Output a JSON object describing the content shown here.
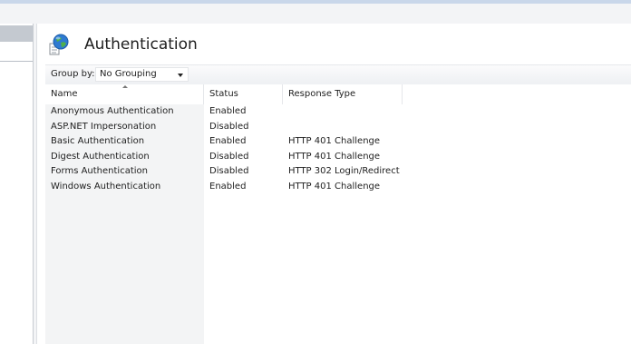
{
  "page": {
    "title": "Authentication",
    "icon": "globe-document-icon"
  },
  "group_by": {
    "label": "Group by:",
    "selected": "No Grouping"
  },
  "table": {
    "columns": [
      "Name",
      "Status",
      "Response Type"
    ],
    "sorted_column": "Name",
    "rows": [
      {
        "name": "Anonymous Authentication",
        "status": "Enabled",
        "response_type": ""
      },
      {
        "name": "ASP.NET Impersonation",
        "status": "Disabled",
        "response_type": ""
      },
      {
        "name": "Basic Authentication",
        "status": "Enabled",
        "response_type": "HTTP 401 Challenge"
      },
      {
        "name": "Digest Authentication",
        "status": "Disabled",
        "response_type": "HTTP 401 Challenge"
      },
      {
        "name": "Forms Authentication",
        "status": "Disabled",
        "response_type": "HTTP 302 Login/Redirect"
      },
      {
        "name": "Windows Authentication",
        "status": "Enabled",
        "response_type": "HTTP 401 Challenge"
      }
    ]
  },
  "colors": {
    "name_column_bg": "#f3f4f5",
    "selection_gray": "#c4c9d0"
  }
}
